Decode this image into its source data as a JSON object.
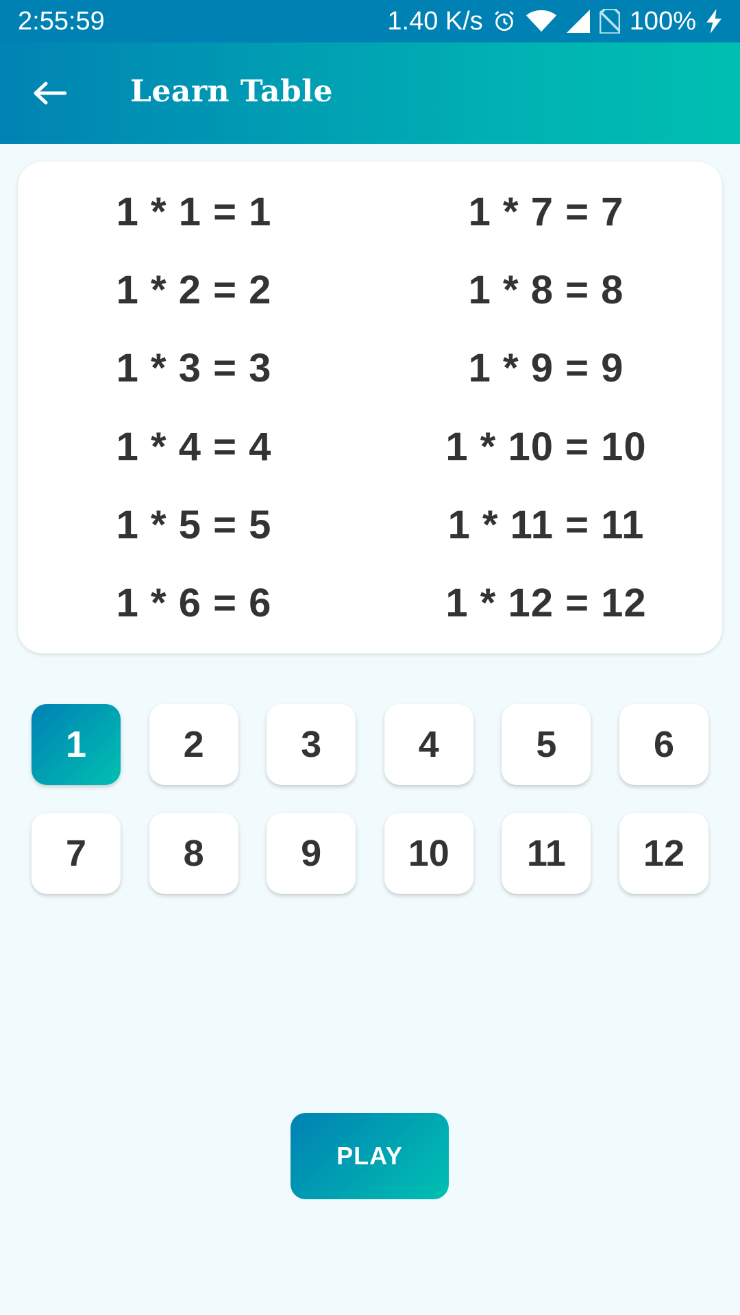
{
  "status_bar": {
    "time": "2:55:59",
    "net_speed": "1.40 K/s",
    "battery": "100%"
  },
  "app_bar": {
    "title": "Learn Table"
  },
  "table": {
    "rows": [
      "1 * 1 = 1",
      "1 * 2 = 2",
      "1 * 3 = 3",
      "1 * 4 = 4",
      "1 * 5 = 5",
      "1 * 6 = 6",
      "1 * 7 = 7",
      "1 * 8 = 8",
      "1 * 9 = 9",
      "1 * 10 = 10",
      "1 * 11 = 11",
      "1 * 12 = 12"
    ]
  },
  "numbers": {
    "items": [
      "1",
      "2",
      "3",
      "4",
      "5",
      "6",
      "7",
      "8",
      "9",
      "10",
      "11",
      "12"
    ],
    "selected": "1"
  },
  "play_label": "PLAY",
  "colors": {
    "status_bar": "#0081b4",
    "gradient_start": "#0081b4",
    "gradient_end": "#00c0b1",
    "background": "#f1fafd",
    "text_dark": "#333333"
  }
}
